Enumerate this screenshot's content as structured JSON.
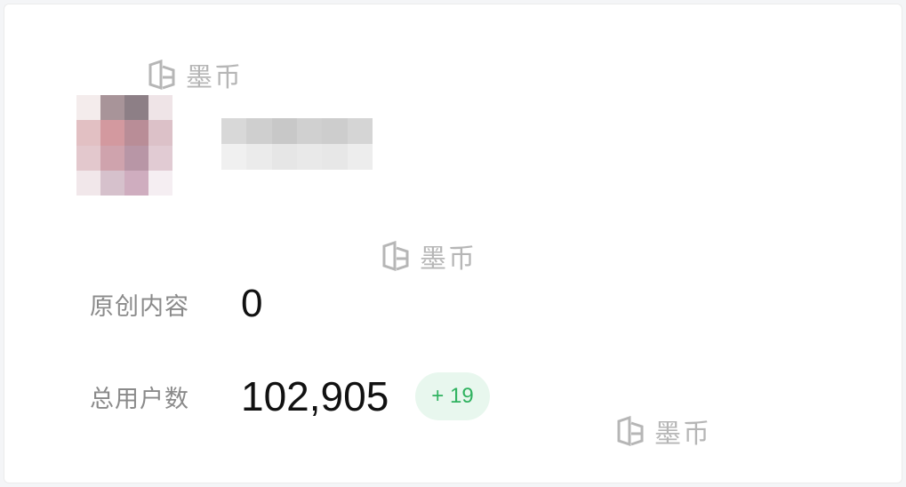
{
  "account": {
    "avatar_colors": [
      "#f4ecec",
      "#a89499",
      "#8d7f86",
      "#efe4e7",
      "#ffffff",
      "#e2c0c3",
      "#d3999f",
      "#b98d97",
      "#dcc1c8",
      "#ffffff",
      "#e3c8cd",
      "#cfa3ad",
      "#b896a6",
      "#e1cbd3",
      "#ffffff",
      "#f1e7ea",
      "#d6c1cc",
      "#cfadbf",
      "#f5eef2",
      "#ffffff"
    ],
    "name_colors": [
      "#d8d8d8",
      "#cfcfcf",
      "#c8c8c8",
      "#d0d0d0",
      "#cdcdcd",
      "#d5d5d5",
      "#f0f0f0",
      "#ebebeb",
      "#e6e6e6",
      "#e9e9e9",
      "#e7e7e7",
      "#ededed"
    ]
  },
  "stats": {
    "original_content": {
      "label": "原创内容",
      "value": "0"
    },
    "total_users": {
      "label": "总用户数",
      "value": "102,905",
      "delta": "+ 19"
    }
  },
  "watermark": {
    "text": "墨币",
    "icon": "logo-icon"
  }
}
